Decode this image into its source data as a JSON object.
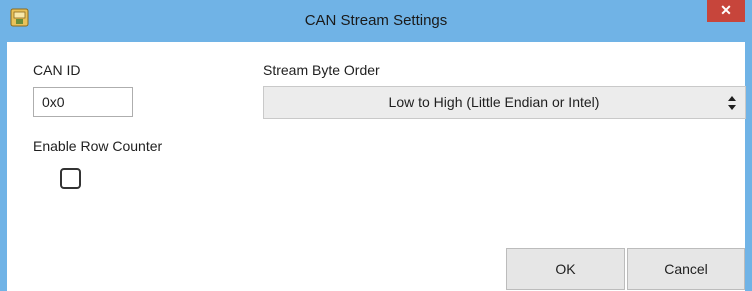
{
  "window": {
    "title": "CAN Stream Settings",
    "close_label": "✕"
  },
  "form": {
    "can_id": {
      "label": "CAN ID",
      "value": "0x0"
    },
    "byte_order": {
      "label": "Stream Byte Order",
      "selected": "Low to High (Little Endian or Intel)"
    },
    "row_counter": {
      "label": "Enable Row Counter",
      "checked": false
    }
  },
  "buttons": {
    "ok_label": "OK",
    "cancel_label": "Cancel"
  },
  "colors": {
    "titlebar": "#70b3e6",
    "close_button": "#c7453b",
    "button_face": "#e6e6e6"
  },
  "icons": {
    "app": "app-settings-icon",
    "close": "close-icon",
    "select": "up-down-arrows-icon"
  }
}
